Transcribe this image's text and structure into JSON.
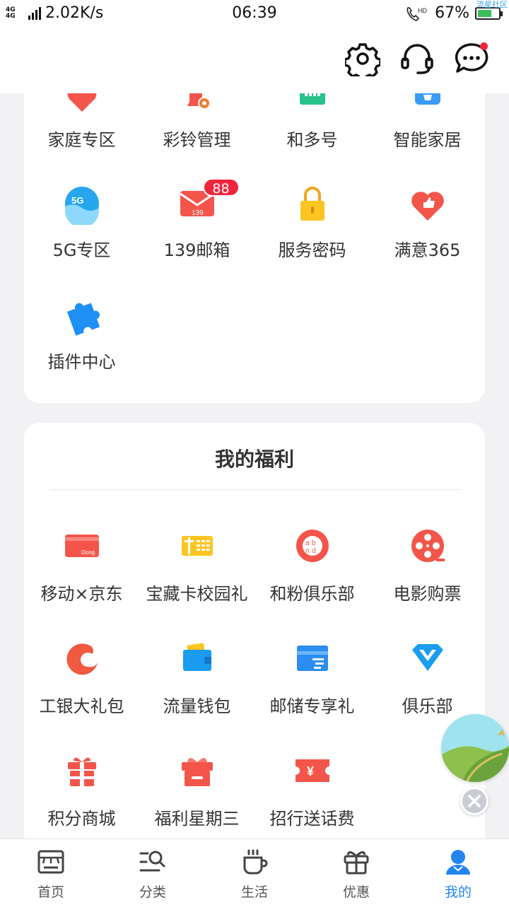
{
  "status_bar": {
    "network": "4G 4G",
    "speed": "2.02K/s",
    "time": "06:39",
    "hd": "HD",
    "battery": "67%",
    "battery_level": 0.67,
    "watermark": "流星社区"
  },
  "header": {
    "icons": [
      "gear-icon",
      "headset-icon",
      "message-icon"
    ]
  },
  "services": {
    "items": [
      {
        "label": "家庭专区",
        "icon": "heart-home-icon"
      },
      {
        "label": "彩铃管理",
        "icon": "bell-gear-icon"
      },
      {
        "label": "和多号",
        "icon": "grid-card-icon"
      },
      {
        "label": "智能家居",
        "icon": "bulb-icon"
      },
      {
        "label": "5G专区",
        "icon": "5g-globe-icon"
      },
      {
        "label": "139邮箱",
        "icon": "mail-icon",
        "badge": "88"
      },
      {
        "label": "服务密码",
        "icon": "lock-icon"
      },
      {
        "label": "满意365",
        "icon": "thumb-heart-icon"
      },
      {
        "label": "插件中心",
        "icon": "puzzle-icon"
      }
    ]
  },
  "welfare": {
    "title": "我的福利",
    "items": [
      {
        "label": "移动×京东",
        "icon": "card-dong-icon"
      },
      {
        "label": "宝藏卡校园礼",
        "icon": "gift-card-icon"
      },
      {
        "label": "和粉俱乐部",
        "icon": "club-circle-icon"
      },
      {
        "label": "电影购票",
        "icon": "film-reel-icon"
      },
      {
        "label": "工银大礼包",
        "icon": "icbc-swirl-icon"
      },
      {
        "label": "流量钱包",
        "icon": "wallet-icon"
      },
      {
        "label": "邮储专享礼",
        "icon": "bank-card-icon"
      },
      {
        "label": "俱乐部",
        "icon": "diamond-v-icon"
      },
      {
        "label": "积分商城",
        "icon": "gift-box-icon"
      },
      {
        "label": "福利星期三",
        "icon": "gift-present-icon"
      },
      {
        "label": "招行送话费",
        "icon": "yen-ticket-icon"
      }
    ]
  },
  "tabs": [
    {
      "label": "首页",
      "icon": "home-icon",
      "active": false
    },
    {
      "label": "分类",
      "icon": "category-search-icon",
      "active": false
    },
    {
      "label": "生活",
      "icon": "cup-icon",
      "active": false
    },
    {
      "label": "优惠",
      "icon": "gift-icon",
      "active": false
    },
    {
      "label": "我的",
      "icon": "user-icon",
      "active": true
    }
  ],
  "colors": {
    "accent_blue": "#2385f0",
    "badge_red": "#f2253c",
    "icon_red": "#f4554a"
  }
}
